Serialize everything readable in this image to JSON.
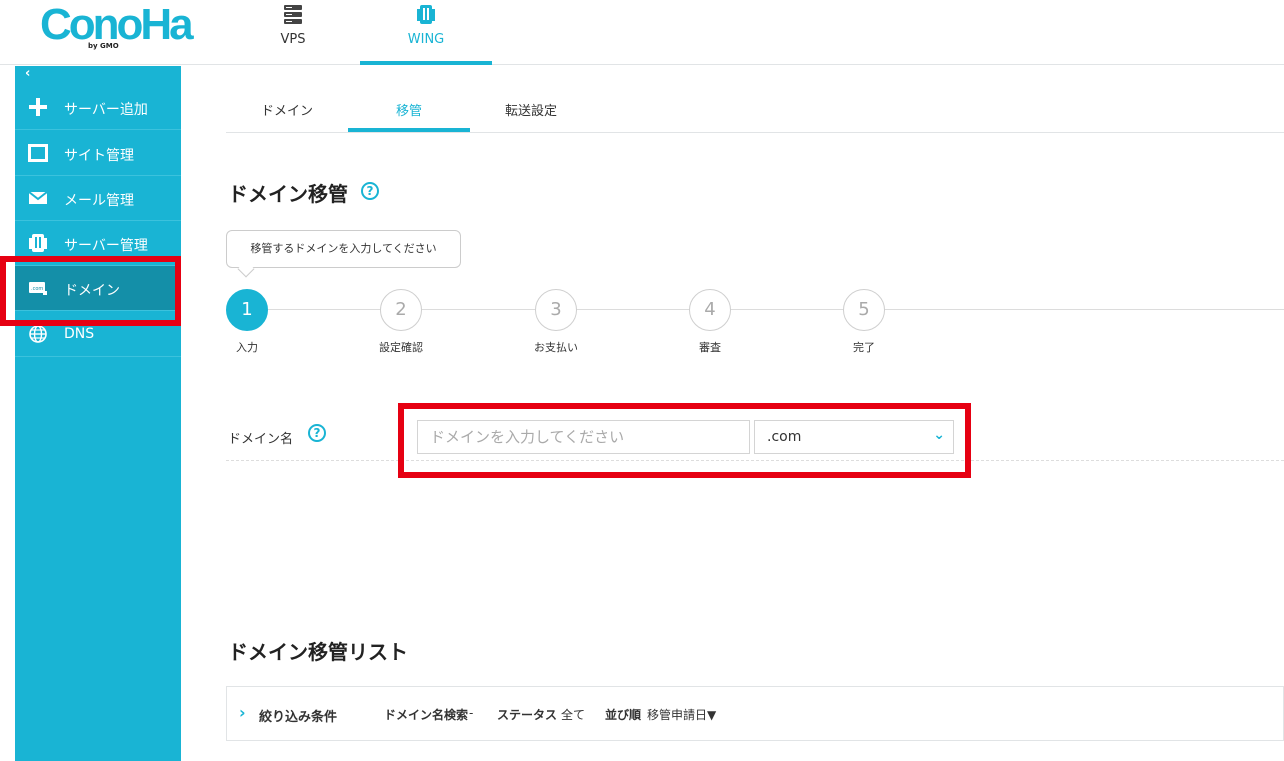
{
  "brand": {
    "logo": "ConoHa",
    "logo_sub": "by GMO"
  },
  "top_nav": {
    "vps": "VPS",
    "wing": "WING"
  },
  "sidebar": {
    "collapse_icon": "chevron-left-icon",
    "items": [
      {
        "label": "サーバー追加",
        "icon": "plus-icon"
      },
      {
        "label": "サイト管理",
        "icon": "window-icon"
      },
      {
        "label": "メール管理",
        "icon": "mail-icon"
      },
      {
        "label": "サーバー管理",
        "icon": "server-icon"
      },
      {
        "label": "ドメイン",
        "icon": "domain-icon"
      },
      {
        "label": "DNS",
        "icon": "globe-icon"
      }
    ]
  },
  "subtabs": {
    "domain": "ドメイン",
    "transfer": "移管",
    "forward": "転送設定"
  },
  "page": {
    "title": "ドメイン移管",
    "tooltip": "移管するドメインを入力してください",
    "steps": [
      {
        "num": "1",
        "label": "入力"
      },
      {
        "num": "2",
        "label": "設定確認"
      },
      {
        "num": "3",
        "label": "お支払い"
      },
      {
        "num": "4",
        "label": "審査"
      },
      {
        "num": "5",
        "label": "完了"
      }
    ],
    "field_label": "ドメイン名",
    "domain_placeholder": "ドメインを入力してください",
    "tld_value": ".com"
  },
  "list": {
    "title": "ドメイン移管リスト",
    "filter_title": "絞り込み条件",
    "search_label": "ドメイン名検索",
    "search_value": "-",
    "status_label": "ステータス",
    "status_value": "全て",
    "sort_label": "並び順",
    "sort_value": "移管申請日▼"
  },
  "colors": {
    "accent": "#19b4d4",
    "highlight": "#e60012"
  }
}
